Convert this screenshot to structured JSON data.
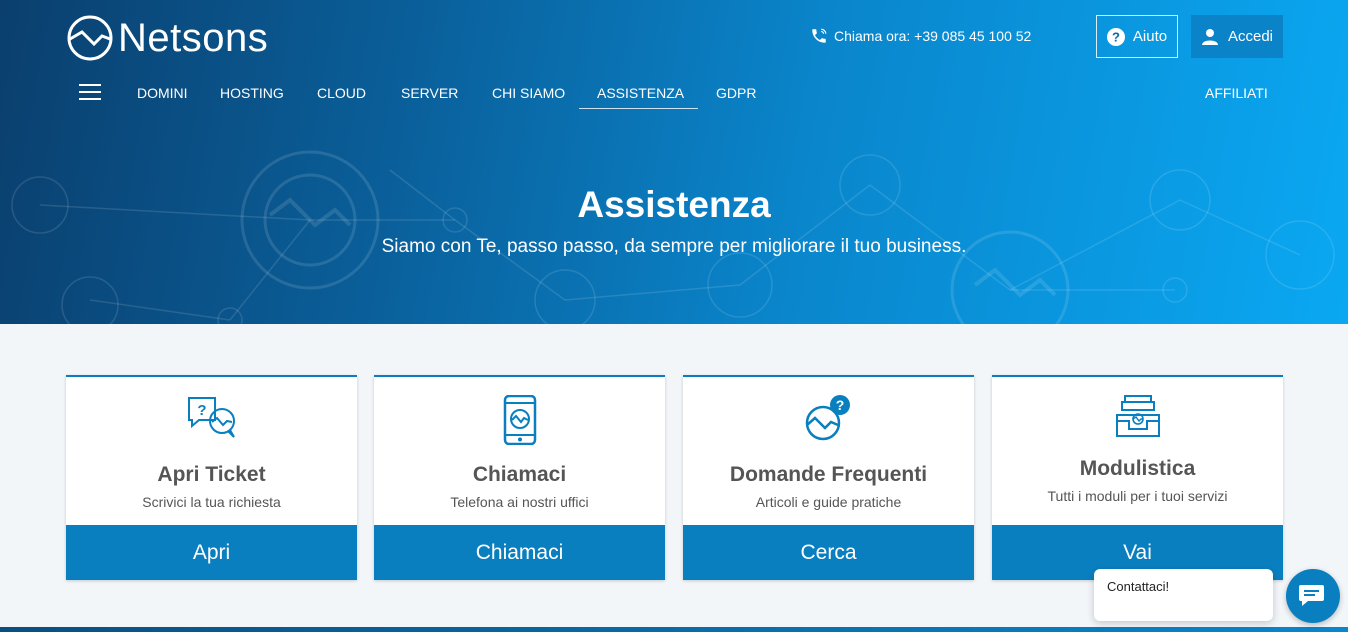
{
  "brand": {
    "name": "Netsons"
  },
  "header": {
    "phone_text": "Chiama ora: +39 085 45 100 52",
    "help_label": "Aiuto",
    "login_label": "Accedi"
  },
  "nav": {
    "items": [
      "DOMINI",
      "HOSTING",
      "CLOUD",
      "SERVER",
      "CHI SIAMO",
      "ASSISTENZA",
      "GDPR"
    ],
    "active": "ASSISTENZA",
    "affiliati": "AFFILIATI"
  },
  "hero": {
    "title": "Assistenza",
    "subtitle": "Siamo con Te, passo passo, da sempre per migliorare il tuo business."
  },
  "cards": [
    {
      "icon": "chat-question-icon",
      "title": "Apri Ticket",
      "desc": "Scrivici la tua richiesta",
      "button": "Apri"
    },
    {
      "icon": "smartphone-icon",
      "title": "Chiamaci",
      "desc": "Telefona ai nostri uffici",
      "button": "Chiamaci"
    },
    {
      "icon": "faq-icon",
      "title": "Domande Frequenti",
      "desc": "Articoli e guide pratiche",
      "button": "Cerca"
    },
    {
      "icon": "document-tray-icon",
      "title": "Modulistica",
      "desc": "Tutti i moduli per i tuoi servizi",
      "button": "Vai"
    }
  ],
  "chat": {
    "label": "Contattaci!"
  },
  "colors": {
    "primary": "#0a7fc0",
    "hero_start": "#0a3f6e",
    "hero_end": "#0aa8f2",
    "text": "#555555"
  }
}
